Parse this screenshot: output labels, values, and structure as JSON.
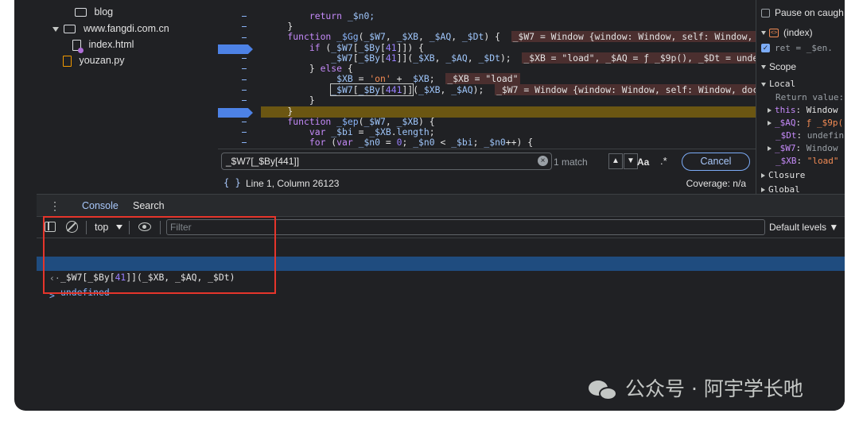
{
  "file_tree": {
    "items": [
      {
        "label": "blog"
      },
      {
        "label": "www.fangdi.com.cn"
      },
      {
        "label": "index.html"
      },
      {
        "label": "youzan.py"
      }
    ]
  },
  "editor": {
    "lines": [
      {
        "text": "        return _$n0;"
      },
      {
        "text": "    }"
      },
      {
        "text": "    function _$Gg(_$W7, _$XB, _$AQ, _$Dt) {  _$W7 = Window {window: Window, self: Window, do"
      },
      {
        "text": "        if (_$W7[_$By[41]]) {"
      },
      {
        "text": "            _$W7[_$By[41]](_$XB, _$AQ, _$Dt);  _$XB = \"load\", _$AQ = ƒ _$9p(), _$Dt = undefi"
      },
      {
        "text": "        } else {"
      },
      {
        "text": "            _$XB = 'on' + _$XB;  _$XB = \"load\""
      },
      {
        "text": "            _$W7[_$By[441]](_$XB, _$AQ);  _$W7 = Window {window: Window, self: Window, docum"
      },
      {
        "text": "        }"
      },
      {
        "text": "    }"
      },
      {
        "text": "    function _$ep(_$W7, _$XB) {"
      },
      {
        "text": "        var _$bi = _$XB.length;"
      },
      {
        "text": "        for (var _$n0 = 0; _$n0 < _$bi; _$n0++) {"
      }
    ]
  },
  "search": {
    "query": "_$W7[_$By[441]]",
    "match_count": "1 match",
    "case_label": "Aa",
    "regex_label": ".*",
    "cancel_label": "Cancel"
  },
  "status": {
    "braces": "{ }",
    "position": "Line 1, Column 26123",
    "coverage": "Coverage: n/a"
  },
  "scope": {
    "pause_label": "Pause on caugh",
    "index_label": "(index)",
    "ret_line": "ret = _$en.",
    "scope_header": "Scope",
    "local_header": "Local",
    "return_value": "Return value:",
    "this_name": "this",
    "this_value": "Window",
    "aq_name": "_$AQ",
    "aq_value": "ƒ _$9p(",
    "dt_name": "_$Dt",
    "dt_value": "undefin",
    "w7_name": "_$W7",
    "w7_value": "Window",
    "xb_name": "_$XB",
    "xb_value": "\"load\"",
    "closure_label": "Closure",
    "global_label": "Global"
  },
  "drawer": {
    "tabs": [
      {
        "label": "Console"
      },
      {
        "label": "Search"
      }
    ]
  },
  "console_toolbar": {
    "context": "top",
    "filter_placeholder": "Filter",
    "levels": "Default levels ▼"
  },
  "console": {
    "input_prompt": ">",
    "input_text_a": "_$W7[_$By[",
    "input_num": "41",
    "input_text_b": "]](_$XB, _$AQ, _$Dt)",
    "result_prompt": "‹·",
    "result_text": "undefined",
    "empty_prompt": ">"
  },
  "colors": {
    "accent": "#a8c7fa",
    "breakpoint": "#4d82e6",
    "paused_line": "#6b5612",
    "annotation": "#e5352b"
  },
  "watermark": {
    "text": "公众号 · 阿宇学长吔"
  }
}
